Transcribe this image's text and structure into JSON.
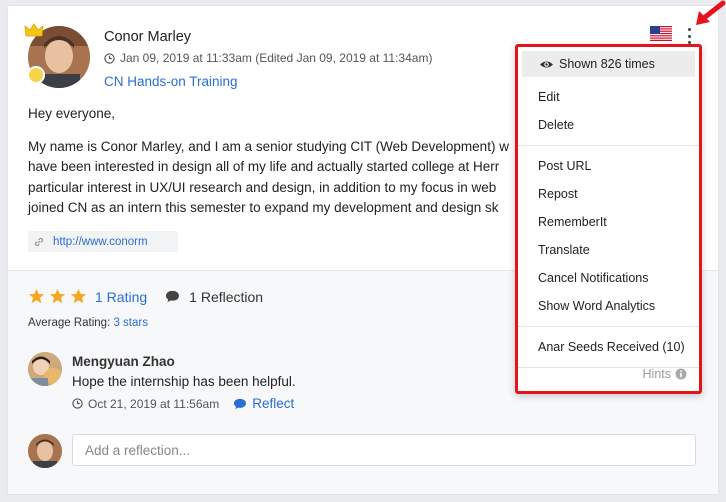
{
  "post": {
    "author": "Conor Marley",
    "timestamp": "Jan 09, 2019 at 11:33am (Edited Jan 09, 2019 at 11:34am)",
    "course": "CN Hands-on Training",
    "greeting": "Hey everyone,",
    "body": "My name is Conor Marley, and I am a senior studying CIT (Web Development) w have been interested in design all of my life and actually started college at Herr particular interest in UX/UI research and design, in addition to my focus in web joined CN as an intern this semester to expand my development and design sk",
    "link": "http://www.conorm"
  },
  "rating": {
    "stars": 3,
    "rating_label": "1 Rating",
    "reflection_label": "1 Reflection",
    "average_prefix": "Average Rating:",
    "average_value": "3 stars"
  },
  "reply": {
    "author": "Mengyuan Zhao",
    "text": "Hope the internship has been helpful.",
    "timestamp": "Oct 21, 2019 at 11:56am",
    "reflect_label": "Reflect"
  },
  "composer": {
    "placeholder": "Add a reflection..."
  },
  "menu": {
    "shown": "Shown 826 times",
    "group1": [
      "Edit",
      "Delete"
    ],
    "group2": [
      "Post URL",
      "Repost",
      "RememberIt",
      "Translate",
      "Cancel Notifications",
      "Show Word Analytics"
    ],
    "group3": [
      "Anar Seeds Received (10)"
    ],
    "hints": "Hints"
  },
  "colors": {
    "accent": "#2b6dd1",
    "highlight": "#e3141b",
    "star": "#f5a623"
  },
  "icons": [
    "crown-icon",
    "clock-icon",
    "link-icon",
    "star-icon",
    "comment-icon",
    "flag-icon",
    "kebab-icon",
    "eye-icon",
    "info-icon",
    "arrow-icon"
  ]
}
